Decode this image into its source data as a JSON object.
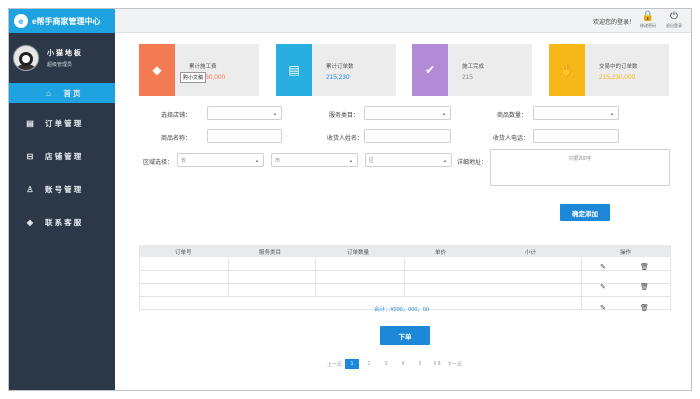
{
  "app": {
    "logo": "e",
    "title": "e帮手商家管理中心"
  },
  "profile": {
    "name": "小 猫 地 板",
    "role": "超级管理员"
  },
  "nav": [
    {
      "label": "首 页",
      "icon": "⌂",
      "icon_name": "home-icon"
    },
    {
      "label": "订 单 管 理",
      "icon": "▤",
      "icon_name": "order-icon"
    },
    {
      "label": "店 铺 管 理",
      "icon": "⊟",
      "icon_name": "shop-icon"
    },
    {
      "label": "账 号 管 理",
      "icon": "♙",
      "icon_name": "user-icon"
    },
    {
      "label": "联 系 客 服",
      "icon": "◈",
      "icon_name": "service-icon"
    }
  ],
  "topbar": {
    "welcome": "欢迎您的登录！",
    "lock_label": "修改密码",
    "logout_label": "退出登录"
  },
  "cards": [
    {
      "label": "累计施工费",
      "value": "215,230,000",
      "color": "#f47a52",
      "value_color": "#f47a52",
      "icon": "◆",
      "icon_name": "tag-icon"
    },
    {
      "label": "累计订单数",
      "value": "215,230",
      "color": "#29aee0",
      "value_color": "#1e88d8",
      "icon": "▤",
      "icon_name": "document-icon"
    },
    {
      "label": "施工完成",
      "value": "215",
      "color": "#b28ad6",
      "value_color": "#888888",
      "icon": "✔",
      "icon_name": "completed-icon"
    },
    {
      "label": "交易中的订单数",
      "value": "215,230,000",
      "color": "#f6b818",
      "value_color": "#f6b818",
      "icon": "✋",
      "icon_name": "handshake-icon"
    }
  ],
  "tooltip": "购小文稿",
  "form": {
    "store_label": "选择店铺：",
    "service_label": "服务类目：",
    "qty_label": "商品数量：",
    "product_label": "商品名称：",
    "receiver_label": "收货人姓名：",
    "phone_label": "收货人电话：",
    "region_label": "区域选择：",
    "province": "省",
    "city": "市",
    "district": "区",
    "address_label": "详细地址：",
    "address_placeholder": "只限200字",
    "submit": "确定添加"
  },
  "table": {
    "headers": [
      "订单号",
      "服务类目",
      "订单数量",
      "单价",
      "小计",
      "操作"
    ],
    "total": "合计：¥200，000，00"
  },
  "order_button": "下单",
  "pager": {
    "prev": "上一页",
    "pages": [
      "1",
      "2",
      "3",
      "4",
      "5"
    ],
    "ellipsis": "6 8",
    "next": "下一页"
  }
}
